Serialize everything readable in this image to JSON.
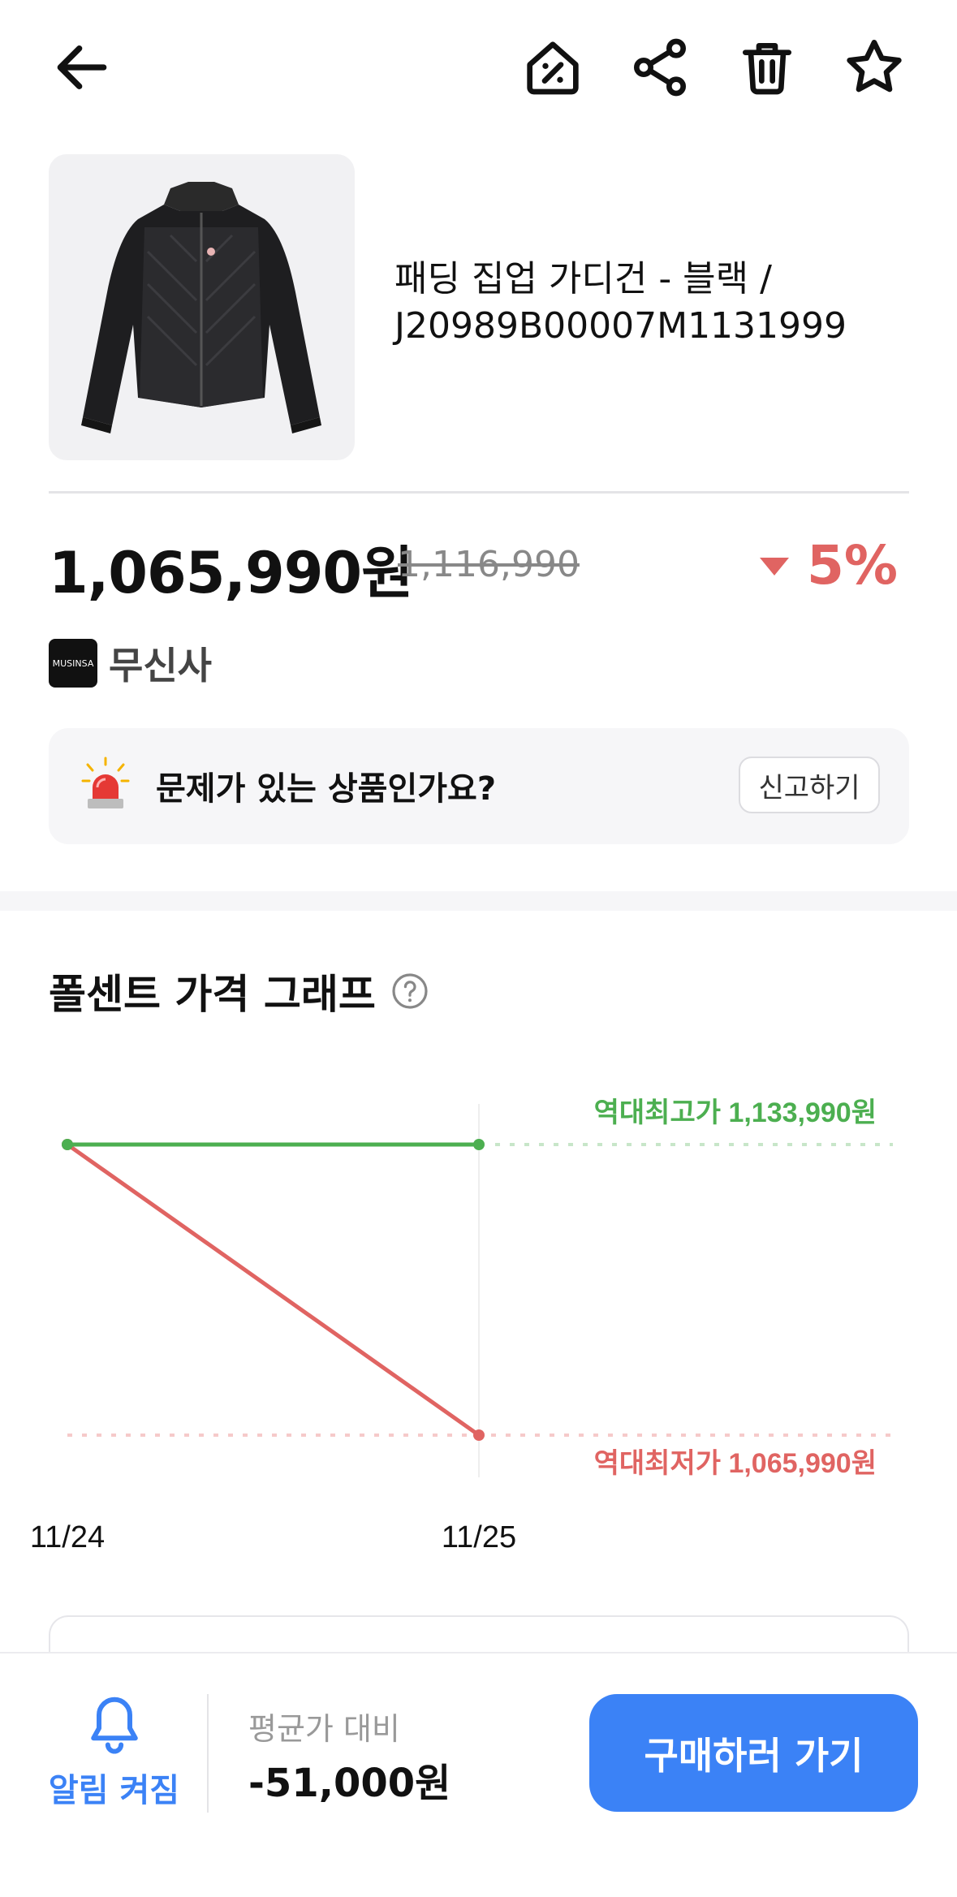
{
  "header": {
    "back_icon": "arrow-left-icon",
    "icons": [
      "discount-tag-icon",
      "share-icon",
      "trash-icon",
      "star-icon"
    ]
  },
  "product": {
    "name": "패딩 집업 가디건 - 블랙 / J20989B00007M1131999",
    "price": "1,065,990원",
    "original_price": "1,116,990",
    "discount_percent": "5%"
  },
  "mall": {
    "logo_text": "MUSINSA",
    "name": "무신사"
  },
  "report": {
    "question": "문제가 있는 상품인가요?",
    "button_label": "신고하기"
  },
  "graph": {
    "title": "폴센트 가격 그래프"
  },
  "chart_data": {
    "type": "line",
    "x": [
      "11/24",
      "11/25"
    ],
    "series": [
      {
        "values": [
          1133990,
          1133990
        ],
        "color": "#4caf50"
      },
      {
        "values": [
          1133990,
          1065990
        ],
        "color": "#e06462"
      }
    ],
    "annotations": {
      "high": "역대최고가 1,133,990원",
      "low": "역대최저가 1,065,990원"
    },
    "high_value": 1133990,
    "low_value": 1065990
  },
  "bottom": {
    "alarm_label": "알림 켜짐",
    "avg_label": "평균가 대비",
    "avg_value": "-51,000원",
    "buy_label": "구매하러 가기"
  },
  "colors": {
    "accent": "#3b82f6",
    "drop": "#e06462",
    "high": "#4caf50"
  }
}
